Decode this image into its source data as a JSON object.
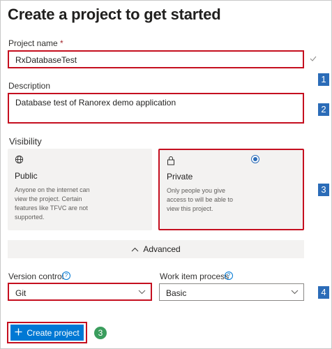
{
  "title": "Create a project to get started",
  "project_name": {
    "label": "Project name",
    "required_mark": "*",
    "value": "RxDatabaseTest"
  },
  "description": {
    "label": "Description",
    "value": "Database test of Ranorex demo application"
  },
  "visibility": {
    "label": "Visibility",
    "public": {
      "title": "Public",
      "desc": "Anyone on the internet can view the project. Certain features like TFVC are not supported."
    },
    "private": {
      "title": "Private",
      "desc": "Only people you give access to will be able to view this project.",
      "selected": true
    }
  },
  "advanced_label": "Advanced",
  "version_control": {
    "label": "Version control",
    "value": "Git"
  },
  "work_item_process": {
    "label": "Work item process",
    "value": "Basic"
  },
  "create_button_label": "Create project",
  "callouts": {
    "c1": "1",
    "c2": "2",
    "c3": "3",
    "c4": "4",
    "c5": "3"
  },
  "colors": {
    "accent": "#0078d4",
    "highlight": "#c50f1f",
    "callout": "#2b6cb8",
    "callout_green": "#3a9d5d"
  },
  "icons": [
    "check-icon",
    "globe-icon",
    "lock-icon",
    "chevron-up-icon",
    "help-icon",
    "chevron-down-icon",
    "plus-icon"
  ]
}
